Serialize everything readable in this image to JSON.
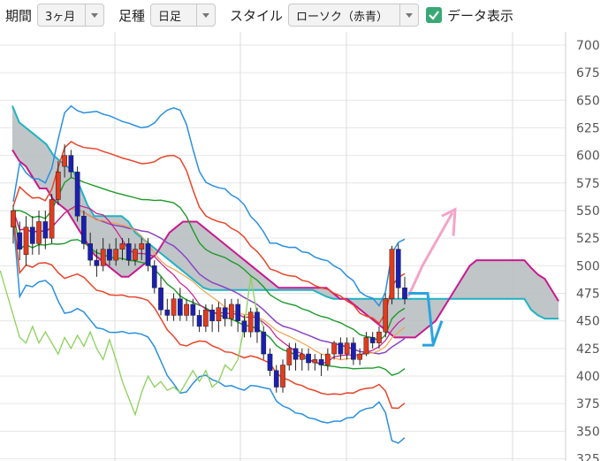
{
  "toolbar": {
    "period_label": "期間",
    "period_value": "3ヶ月",
    "ashi_label": "足種",
    "ashi_value": "日足",
    "style_label": "スタイル",
    "style_value": "ローソク（赤青）",
    "data_label": "データ表示",
    "data_checked": true
  },
  "colors": {
    "cloud": "#b9bfc2",
    "cloud_top": "#1fb3c2",
    "cloud_bottom": "#c8198f",
    "candle_up": "#e23b1f",
    "candle_down": "#1a1fb3",
    "arrow_up": "#f3a4c8",
    "arrow_down": "#29a3df",
    "bb_outer": "#2a8fdf",
    "bb_inner": "#e8452a",
    "bb_mid": "#1e9a2a",
    "ma": "#8a45c4",
    "lagging": "#8bd25a",
    "orange": "#f0a24a"
  },
  "chart_data": {
    "type": "line",
    "y_ticks": [
      "700",
      "675",
      "650",
      "625",
      "600",
      "575",
      "550",
      "525",
      "500",
      "475",
      "450",
      "425",
      "400",
      "375",
      "350",
      "325"
    ],
    "ylim": [
      323,
      712
    ],
    "grid": true,
    "candles": [
      [
        535,
        550,
        520,
        555
      ],
      [
        530,
        515,
        505,
        540
      ],
      [
        510,
        535,
        500,
        545
      ],
      [
        535,
        520,
        510,
        545
      ],
      [
        520,
        540,
        510,
        550
      ],
      [
        540,
        525,
        515,
        550
      ],
      [
        525,
        560,
        520,
        565
      ],
      [
        560,
        585,
        555,
        595
      ],
      [
        590,
        600,
        580,
        610
      ],
      [
        600,
        585,
        580,
        605
      ],
      [
        585,
        545,
        540,
        590
      ],
      [
        545,
        520,
        515,
        550
      ],
      [
        520,
        505,
        500,
        530
      ],
      [
        505,
        500,
        490,
        515
      ],
      [
        500,
        515,
        495,
        525
      ],
      [
        515,
        505,
        500,
        520
      ],
      [
        505,
        515,
        500,
        525
      ],
      [
        515,
        520,
        505,
        525
      ],
      [
        520,
        505,
        500,
        525
      ],
      [
        505,
        515,
        500,
        520
      ],
      [
        515,
        520,
        505,
        525
      ],
      [
        520,
        500,
        495,
        525
      ],
      [
        500,
        480,
        475,
        505
      ],
      [
        480,
        460,
        455,
        490
      ],
      [
        460,
        455,
        450,
        470
      ],
      [
        455,
        470,
        450,
        475
      ],
      [
        470,
        455,
        450,
        480
      ],
      [
        455,
        465,
        450,
        470
      ],
      [
        465,
        455,
        445,
        470
      ],
      [
        455,
        445,
        440,
        460
      ],
      [
        445,
        460,
        440,
        465
      ],
      [
        460,
        450,
        440,
        465
      ],
      [
        450,
        462,
        440,
        467
      ],
      [
        462,
        452,
        445,
        470
      ],
      [
        452,
        465,
        445,
        470
      ],
      [
        465,
        450,
        440,
        470
      ],
      [
        450,
        440,
        435,
        455
      ],
      [
        440,
        458,
        435,
        462
      ],
      [
        458,
        440,
        430,
        462
      ],
      [
        440,
        420,
        415,
        445
      ],
      [
        420,
        405,
        400,
        425
      ],
      [
        405,
        390,
        385,
        410
      ],
      [
        390,
        410,
        385,
        415
      ],
      [
        410,
        425,
        405,
        430
      ],
      [
        425,
        415,
        405,
        430
      ],
      [
        415,
        420,
        405,
        425
      ],
      [
        420,
        412,
        405,
        425
      ],
      [
        412,
        415,
        405,
        420
      ],
      [
        415,
        410,
        400,
        420
      ],
      [
        410,
        420,
        405,
        425
      ],
      [
        420,
        430,
        415,
        432
      ],
      [
        430,
        420,
        415,
        435
      ],
      [
        420,
        430,
        415,
        435
      ],
      [
        430,
        415,
        410,
        435
      ],
      [
        415,
        420,
        410,
        425
      ],
      [
        420,
        435,
        418,
        440
      ],
      [
        435,
        430,
        425,
        440
      ],
      [
        430,
        440,
        425,
        445
      ],
      [
        440,
        470,
        435,
        475
      ],
      [
        470,
        515,
        465,
        518
      ],
      [
        515,
        480,
        470,
        520
      ],
      [
        480,
        470,
        465,
        490
      ]
    ],
    "cloud_upper": [
      645,
      630,
      625,
      620,
      615,
      610,
      600,
      595,
      590,
      585,
      570,
      555,
      545,
      545,
      545,
      545,
      545,
      540,
      530,
      525,
      520,
      515,
      510,
      505,
      500,
      495,
      490,
      485,
      480,
      478,
      478,
      478,
      478,
      478,
      478,
      478,
      478,
      478,
      478,
      478,
      478,
      478,
      478,
      478,
      478,
      475,
      472,
      470,
      470,
      470,
      470,
      470,
      470,
      470,
      470,
      470,
      470,
      470,
      470,
      470,
      470,
      470,
      470,
      470,
      470,
      470,
      470,
      470,
      470,
      470,
      470,
      470,
      470,
      470,
      470,
      470,
      460,
      455,
      452,
      452,
      452
    ],
    "cloud_lower": [
      605,
      595,
      590,
      580,
      570,
      570,
      560,
      555,
      550,
      540,
      530,
      520,
      510,
      505,
      500,
      495,
      490,
      490,
      495,
      500,
      505,
      510,
      520,
      530,
      535,
      540,
      540,
      540,
      535,
      530,
      525,
      520,
      515,
      510,
      505,
      500,
      495,
      490,
      485,
      480,
      480,
      480,
      480,
      480,
      480,
      480,
      480,
      475,
      470,
      470,
      465,
      460,
      455,
      450,
      445,
      440,
      435,
      435,
      435,
      435,
      440,
      445,
      450,
      460,
      470,
      480,
      490,
      500,
      505,
      505,
      505,
      505,
      505,
      505,
      505,
      505,
      498,
      492,
      488,
      478,
      468
    ]
  }
}
